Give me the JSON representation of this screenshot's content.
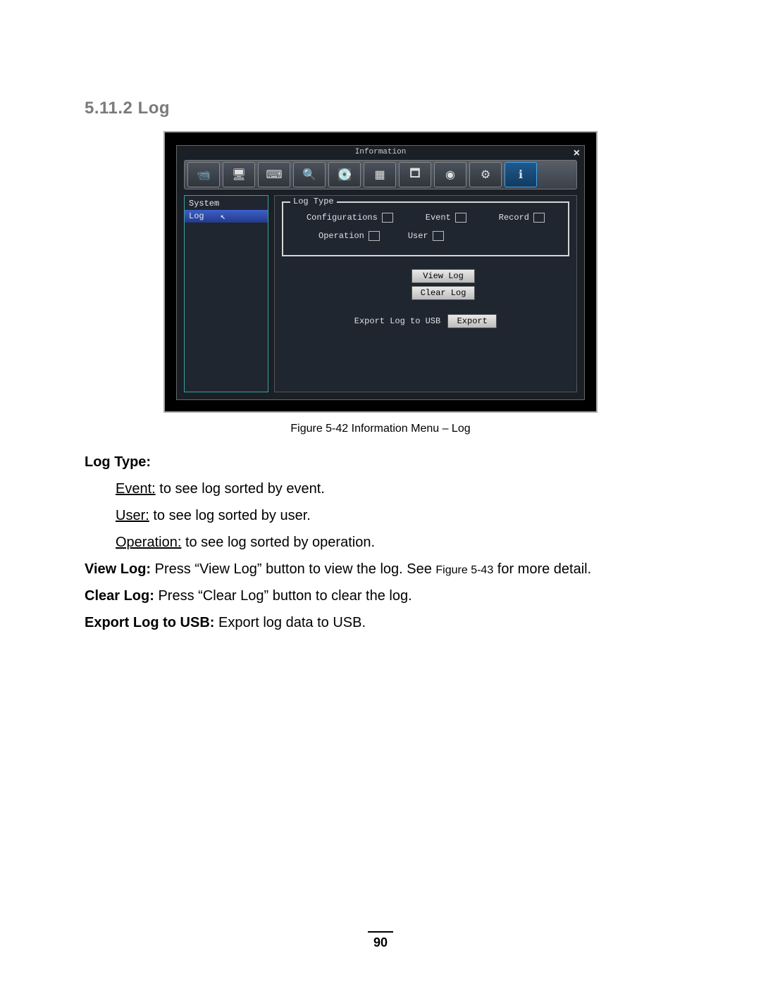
{
  "heading": "5.11.2 Log",
  "window": {
    "title": "Information",
    "sidebar": {
      "items": [
        {
          "label": "System",
          "selected": false
        },
        {
          "label": "Log",
          "selected": true
        }
      ]
    },
    "fieldset_legend": "Log Type",
    "checkboxes": {
      "configurations": "Configurations",
      "event": "Event",
      "record": "Record",
      "operation": "Operation",
      "user": "User"
    },
    "buttons": {
      "view_log": "View Log",
      "clear_log": "Clear Log",
      "export": "Export"
    },
    "export_label": "Export Log to USB",
    "toolbar_icons": [
      "camera",
      "display",
      "keyboard",
      "search",
      "disk",
      "grid",
      "ptz",
      "record",
      "gear",
      "info"
    ]
  },
  "caption": "Figure 5-42 Information Menu – Log",
  "doc": {
    "log_type_heading": "Log Type:",
    "event_term": "Event:",
    "event_desc": " to see log sorted by event.",
    "user_term": "User:",
    "user_desc": " to see log sorted by user.",
    "operation_term": "Operation:",
    "operation_desc": " to see log sorted by operation.",
    "view_log_term": "View Log:",
    "view_log_desc_a": " Press “View Log” button to view the log. See ",
    "view_log_ref": "Figure 5-43",
    "view_log_desc_b": " for more detail.",
    "clear_log_term": "Clear Log:",
    "clear_log_desc": " Press “Clear Log” button to clear the log.",
    "export_term": "Export Log to USB:",
    "export_desc": " Export log data to USB."
  },
  "page_number": "90"
}
